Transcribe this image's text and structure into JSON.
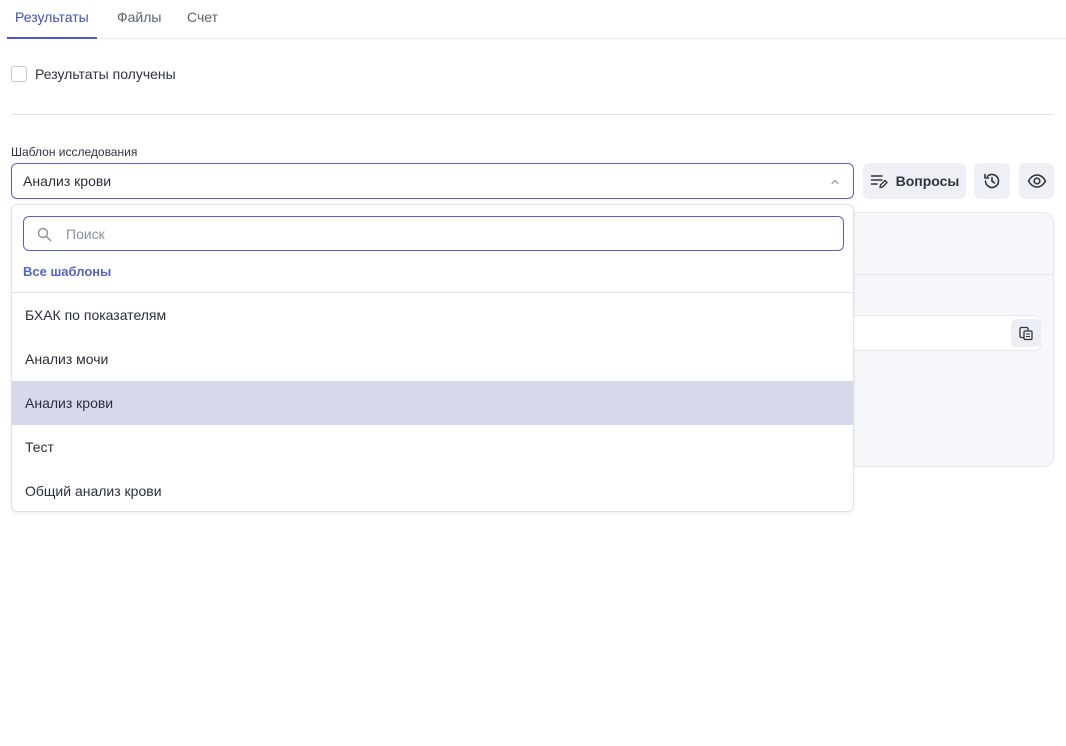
{
  "tabs": [
    {
      "label": "Результаты",
      "active": true
    },
    {
      "label": "Файлы",
      "active": false
    },
    {
      "label": "Счет",
      "active": false
    }
  ],
  "results_checkbox": {
    "label": "Результаты получены",
    "checked": false
  },
  "template_field": {
    "label": "Шаблон исследования",
    "value": "Анализ крови"
  },
  "actions": {
    "questions_label": "Вопросы"
  },
  "dropdown": {
    "search_placeholder": "Поиск",
    "all_templates_label": "Все шаблоны",
    "options": [
      "БХАК по показателям",
      "Анализ мочи",
      "Анализ крови",
      "Тест",
      "Общий анализ крови"
    ],
    "selected_option": "Анализ крови"
  },
  "colors": {
    "accent": "#4756c9",
    "selected_bg": "#d6d9ea",
    "button_bg": "#eef0f5"
  }
}
